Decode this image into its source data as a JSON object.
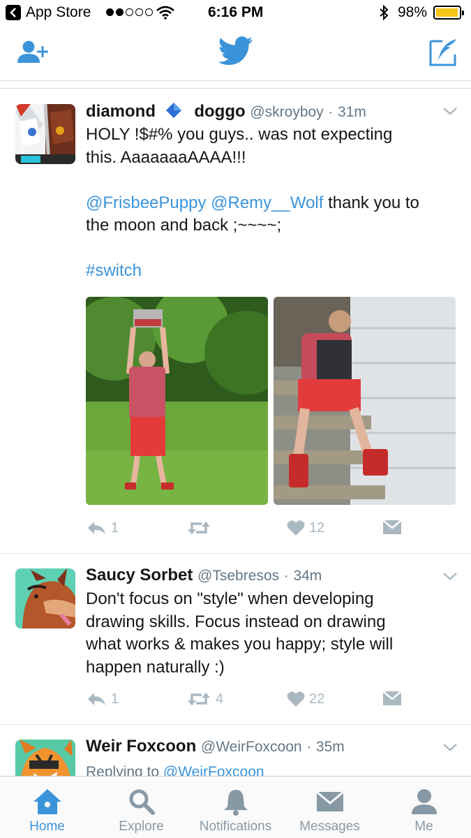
{
  "status_bar": {
    "back_app": "App Store",
    "time": "6:16 PM",
    "battery": "98%",
    "battery_level": 0.98,
    "signal_bars": 2
  },
  "nav": {
    "left_icon": "add-user-icon",
    "center_icon": "twitter-bird-icon",
    "right_icon": "compose-icon"
  },
  "tweets": [
    {
      "name_part1": "diamond",
      "name_part2": "doggo",
      "handle": "@skroyboy",
      "dot": "·",
      "time": "31m",
      "text_line1": "HOLY !$#% you guys.. was not expecting",
      "text_line2": "this. AaaaaaaAAAA!!!",
      "mention1": "@FrisbeePuppy",
      "mention2": "@Remy__Wolf",
      "text_after_mentions": " thank you to",
      "text_line4": "the moon and back ;~~~~;",
      "hashtag": "#switch",
      "reply_count": "1",
      "retweet_count": "",
      "like_count": "12"
    },
    {
      "name": "Saucy Sorbet",
      "handle": "@Tsebresos",
      "dot": "·",
      "time": "34m",
      "text_line1": "Don't focus on \"style\" when developing",
      "text_line2": "drawing skills. Focus instead on drawing",
      "text_line3": "what works & makes you happy; style will",
      "text_line4": "happen naturally :)",
      "reply_count": "1",
      "retweet_count": "4",
      "like_count": "22"
    },
    {
      "name": "Weir Foxcoon",
      "handle": "@WeirFoxcoon",
      "dot": "·",
      "time": "35m",
      "replying_prefix": "Replying to ",
      "replying_handle": "@WeirFoxcoon"
    }
  ],
  "tab_bar": [
    {
      "label": "Home",
      "icon": "home-icon",
      "active": true
    },
    {
      "label": "Explore",
      "icon": "search-icon",
      "active": false
    },
    {
      "label": "Notifications",
      "icon": "bell-icon",
      "active": false
    },
    {
      "label": "Messages",
      "icon": "envelope-icon",
      "active": false
    },
    {
      "label": "Me",
      "icon": "person-icon",
      "active": false
    }
  ],
  "colors": {
    "accent": "#3b94d9",
    "muted": "#8899a6",
    "action_gray": "#aab8c2",
    "battery_fill": "#f5c518"
  }
}
